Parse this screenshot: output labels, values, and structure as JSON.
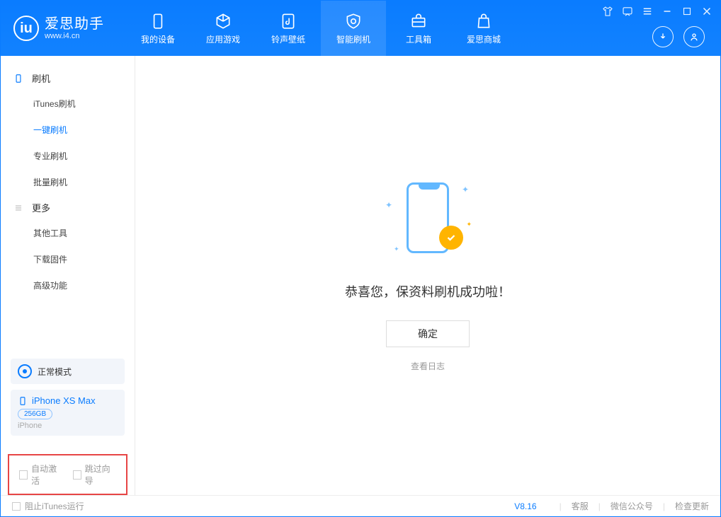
{
  "app": {
    "name_cn": "爱思助手",
    "name_en": "www.i4.cn"
  },
  "nav": {
    "tabs": [
      {
        "label": "我的设备"
      },
      {
        "label": "应用游戏"
      },
      {
        "label": "铃声壁纸"
      },
      {
        "label": "智能刷机"
      },
      {
        "label": "工具箱"
      },
      {
        "label": "爱思商城"
      }
    ]
  },
  "sidebar": {
    "section_flash": "刷机",
    "items_flash": [
      {
        "label": "iTunes刷机"
      },
      {
        "label": "一键刷机"
      },
      {
        "label": "专业刷机"
      },
      {
        "label": "批量刷机"
      }
    ],
    "section_more": "更多",
    "items_more": [
      {
        "label": "其他工具"
      },
      {
        "label": "下载固件"
      },
      {
        "label": "高级功能"
      }
    ],
    "mode_label": "正常模式",
    "device": {
      "name": "iPhone XS Max",
      "capacity": "256GB",
      "type": "iPhone"
    },
    "checks": {
      "auto_activate": "自动激活",
      "skip_guide": "跳过向导"
    }
  },
  "main": {
    "success_text": "恭喜您，保资料刷机成功啦！",
    "ok_label": "确定",
    "log_label": "查看日志"
  },
  "statusbar": {
    "block_itunes": "阻止iTunes运行",
    "version": "V8.16",
    "links": {
      "service": "客服",
      "wechat": "微信公众号",
      "update": "检查更新"
    }
  }
}
